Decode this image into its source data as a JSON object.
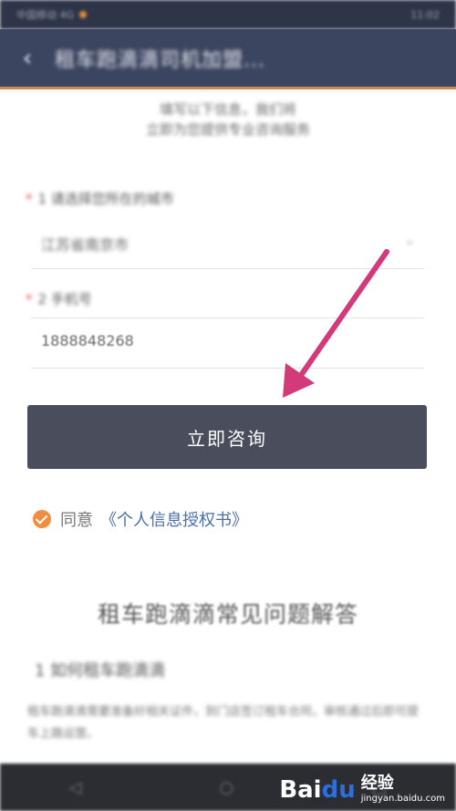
{
  "statusbar": {
    "left": "中国移动 4G",
    "right": "11:02"
  },
  "header": {
    "back_icon": "chevron-left-icon",
    "title": "租车跑滴滴司机加盟..."
  },
  "intro": {
    "line1": "填写以下信息，我们将",
    "line2": "立即为您提供专业咨询服务"
  },
  "form": {
    "field1": {
      "label": "1  请选择您所在的城市",
      "value": "江苏省南京市",
      "chevron": "⌄"
    },
    "field2": {
      "label": "2  手机号",
      "value": "1888848268"
    }
  },
  "consult_button": {
    "label": "立即咨询"
  },
  "agreement": {
    "label": "同意",
    "link": "《个人信息授权书》"
  },
  "faq": {
    "title": "租车跑滴滴常见问题解答",
    "item_label": "1  如何租车跑滴滴",
    "text": "租车跑滴滴需要准备好相关证件，到门店签订租车合同，审核通过后即可提车上路运营。"
  },
  "navbar": {
    "items": [
      "◁",
      "○",
      "□"
    ]
  },
  "watermark": {
    "logo_a": "Bai",
    "logo_b": "du",
    "cn": "经验",
    "url": "jingyan.baidu.com"
  },
  "colors": {
    "header": "#3c4560",
    "button": "#4a4d5c",
    "checkbox": "#f08d43",
    "link": "#4a6fa5",
    "arrow": "#d23a7a"
  }
}
